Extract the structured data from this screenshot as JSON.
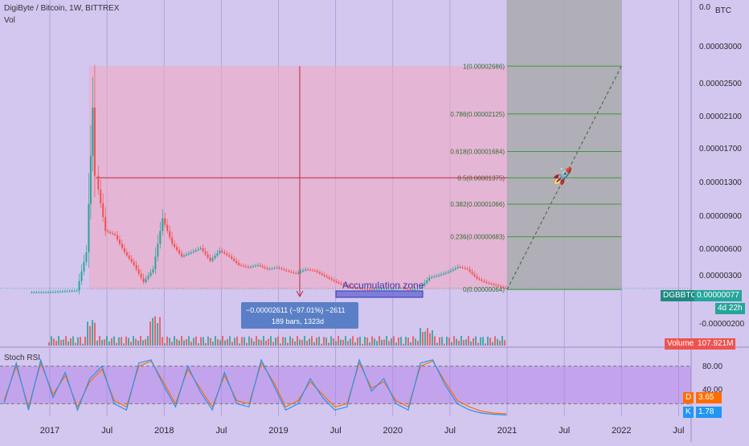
{
  "header": {
    "symbol_line": "DigiByte / Bitcoin, 1W, BITTREX",
    "vol_label": "Vol"
  },
  "price_axis": {
    "currency": "BTC",
    "ticks": [
      "0.0",
      "0.00003000",
      "0.00002500",
      "0.00002100",
      "0.00001700",
      "0.00001300",
      "0.00000900",
      "0.00000600",
      "0.00000300",
      "-0.00000200"
    ]
  },
  "time_axis": {
    "ticks": [
      "2017",
      "Jul",
      "2018",
      "Jul",
      "2019",
      "Jul",
      "2020",
      "Jul",
      "2021",
      "Jul",
      "2022",
      "Jul"
    ]
  },
  "fib_levels": [
    {
      "label": "1(0.00002686)",
      "value": 2.686e-05
    },
    {
      "label": "0.786(0.00002125)",
      "value": 2.125e-05
    },
    {
      "label": "0.618(0.00001684)",
      "value": 1.684e-05
    },
    {
      "label": "0.5(0.00001375)",
      "value": 1.375e-05
    },
    {
      "label": "0.382(0.00001066)",
      "value": 1.066e-05
    },
    {
      "label": "0.236(0.00000683)",
      "value": 6.83e-06
    },
    {
      "label": "0(0.00000064)",
      "value": 6.4e-07
    }
  ],
  "measure_box": {
    "line1": "−0.00002611 (−97.01%) −2611",
    "line2": "189 bars, 1323d"
  },
  "annotation": {
    "text": "Accumulation zone"
  },
  "last_price": {
    "symbol": "DGBBTC",
    "value": "0.00000077",
    "countdown": "4d 22h"
  },
  "volume": {
    "label": "Volume",
    "value": "107.921M"
  },
  "stoch_rsi": {
    "title": "Stoch RSI",
    "ticks": [
      "80.00",
      "40.00"
    ],
    "d_label": "D",
    "d_value": "3.65",
    "k_label": "K",
    "k_value": "1.78"
  },
  "colors": {
    "background": "#d3c6ef",
    "bull": "#26a69a",
    "bear": "#ef5350",
    "fib_line": "#3f9a3f",
    "rsi_k": "#2196f3",
    "rsi_d": "#ff6d00",
    "projection_zone": "#a8a8a8"
  },
  "chart_data": {
    "type": "line",
    "title": "DigiByte / Bitcoin, 1W, BITTREX",
    "ylabel": "BTC",
    "ylim": [
      -3e-06,
      3.25e-05
    ],
    "series": [
      {
        "name": "DGBBTC",
        "x": [
          "2016-11",
          "2017-01",
          "2017-04",
          "2017-05",
          "2017-05-20",
          "2017-06",
          "2017-07",
          "2017-08",
          "2017-09",
          "2017-10",
          "2017-11",
          "2017-12",
          "2018-01",
          "2018-02",
          "2018-03",
          "2018-04",
          "2018-05",
          "2018-06",
          "2018-07",
          "2018-08",
          "2018-09",
          "2018-10",
          "2018-11",
          "2018-12",
          "2019-01",
          "2019-02",
          "2019-03",
          "2019-04",
          "2019-05",
          "2019-06",
          "2019-07",
          "2019-08",
          "2019-09",
          "2019-10",
          "2019-11",
          "2019-12",
          "2020-01",
          "2020-02",
          "2020-03",
          "2020-04",
          "2020-05",
          "2020-06",
          "2020-07",
          "2020-08",
          "2020-09",
          "2020-10",
          "2020-11",
          "2020-12",
          "2021-01"
        ],
        "values": [
          3e-07,
          3e-07,
          5e-07,
          5e-06,
          2.2e-05,
          1.4e-05,
          7.5e-06,
          7e-06,
          5e-06,
          3.5e-06,
          1.5e-06,
          3e-06,
          9e-06,
          6e-06,
          4.5e-06,
          5e-06,
          5.5e-06,
          4e-06,
          5.2e-06,
          4.5e-06,
          3.5e-06,
          3.2e-06,
          3.5e-06,
          3e-06,
          3.2e-06,
          2.8e-06,
          2.5e-06,
          3e-06,
          2.8e-06,
          2.2e-06,
          1.6e-06,
          1.1e-06,
          8e-07,
          7e-07,
          6.5e-07,
          7e-07,
          7e-07,
          8e-07,
          6e-07,
          8e-07,
          2e-06,
          2.3e-06,
          2.7e-06,
          3.3e-06,
          3e-06,
          1.9e-06,
          1.4e-06,
          1.1e-06,
          7.7e-07
        ]
      }
    ],
    "fib_levels": [
      2.686e-05,
      2.125e-05,
      1.684e-05,
      1.375e-05,
      1.066e-05,
      6.83e-06,
      6.4e-07
    ],
    "projection_x": [
      "2021-01",
      "2022-01"
    ],
    "projection_y": [
      6.4e-07,
      2.686e-05
    ],
    "stoch_rsi": {
      "ylim": [
        0,
        100
      ],
      "k": [
        20,
        85,
        10,
        90,
        30,
        70,
        10,
        60,
        80,
        20,
        10,
        85,
        90,
        50,
        15,
        80,
        40,
        10,
        70,
        20,
        15,
        90,
        50,
        10,
        20,
        60,
        30,
        10,
        15,
        90,
        40,
        60,
        20,
        10,
        85,
        90,
        50,
        20,
        10,
        5,
        3,
        2
      ],
      "d": [
        25,
        80,
        15,
        85,
        35,
        65,
        15,
        55,
        75,
        25,
        15,
        80,
        88,
        55,
        20,
        75,
        45,
        15,
        65,
        25,
        20,
        85,
        55,
        15,
        25,
        55,
        35,
        15,
        20,
        85,
        45,
        55,
        25,
        15,
        80,
        88,
        55,
        25,
        15,
        8,
        5,
        4
      ]
    }
  }
}
